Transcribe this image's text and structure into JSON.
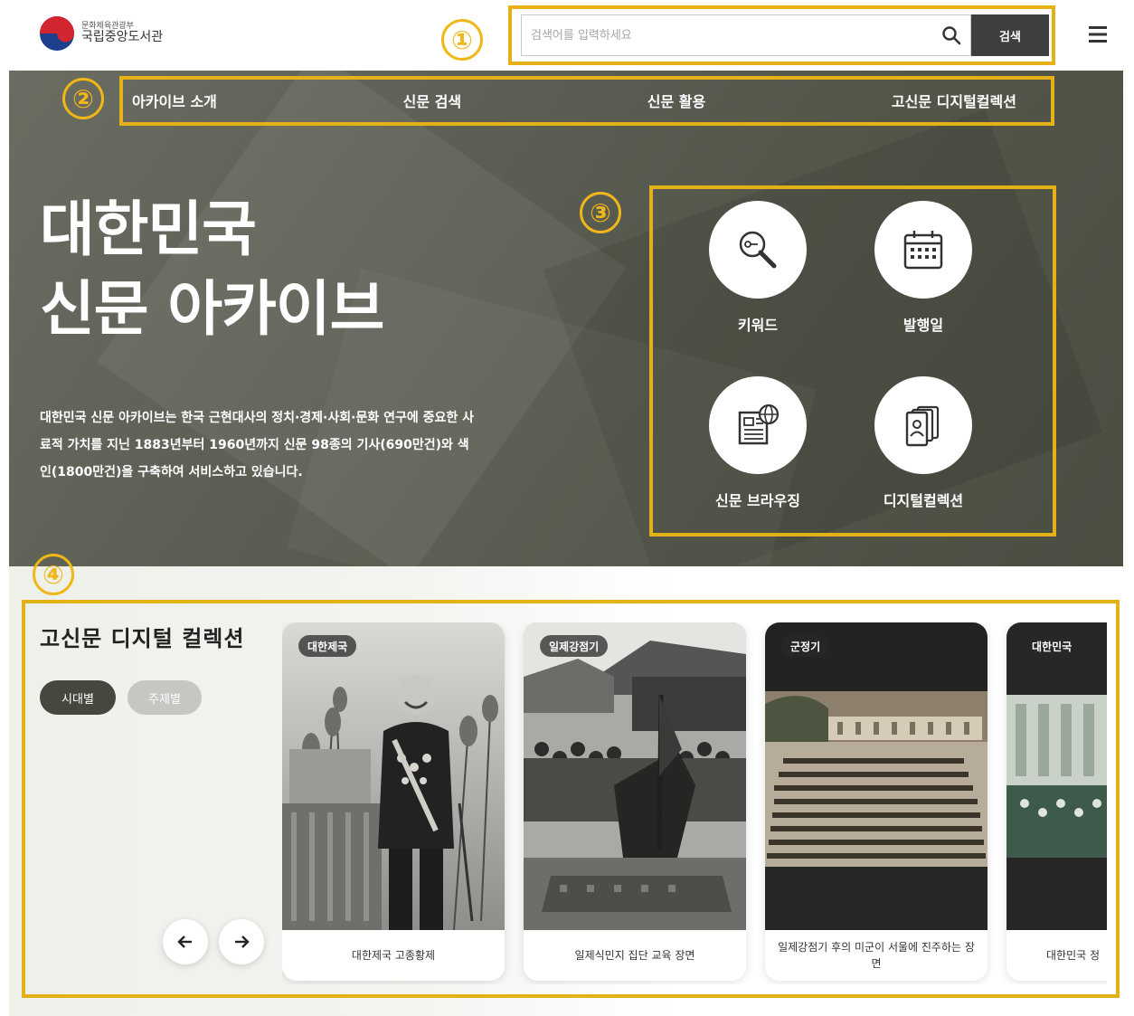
{
  "header": {
    "logo_sub": "문화체육관광부",
    "logo_main": "국립중앙도서관",
    "search_placeholder": "검색어를 입력하세요",
    "search_button": "검색"
  },
  "badges": [
    "①",
    "②",
    "③",
    "④"
  ],
  "nav": {
    "items": [
      {
        "label": "아카이브 소개"
      },
      {
        "label": "신문 검색"
      },
      {
        "label": "신문 활용"
      },
      {
        "label": "고신문 디지털컬렉션"
      }
    ]
  },
  "hero": {
    "title_line1": "대한민국",
    "title_line2": "신문 아카이브",
    "description": "대한민국 신문 아카이브는 한국 근현대사의 정치·경제·사회·문화 연구에 중요한 사료적 가치를 지닌 1883년부터 1960년까지 신문 98종의 기사(690만건)와 색인(1800만건)을 구축하여 서비스하고 있습니다."
  },
  "quick_links": [
    {
      "label": "키워드",
      "icon": "keyword-search-icon"
    },
    {
      "label": "발행일",
      "icon": "calendar-icon"
    },
    {
      "label": "신문 브라우징",
      "icon": "newspaper-globe-icon"
    },
    {
      "label": "디지털컬렉션",
      "icon": "collection-cards-icon"
    }
  ],
  "collection": {
    "title": "고신문 디지털 컬렉션",
    "filters": [
      "시대별",
      "주제별"
    ],
    "cards": [
      {
        "tag": "대한제국",
        "caption": "대한제국 고종황제"
      },
      {
        "tag": "일제강점기",
        "caption": "일제식민지 집단 교육 장면"
      },
      {
        "tag": "군정기",
        "caption": "일제강점기 후의 미군이 서울에 진주하는 장면"
      },
      {
        "tag": "대한민국",
        "caption": "대한민국 정"
      }
    ]
  },
  "colors": {
    "accent_outline": "#e6b017",
    "hero_bg": "#5c5f54",
    "search_button_bg": "#3c3f3b"
  }
}
